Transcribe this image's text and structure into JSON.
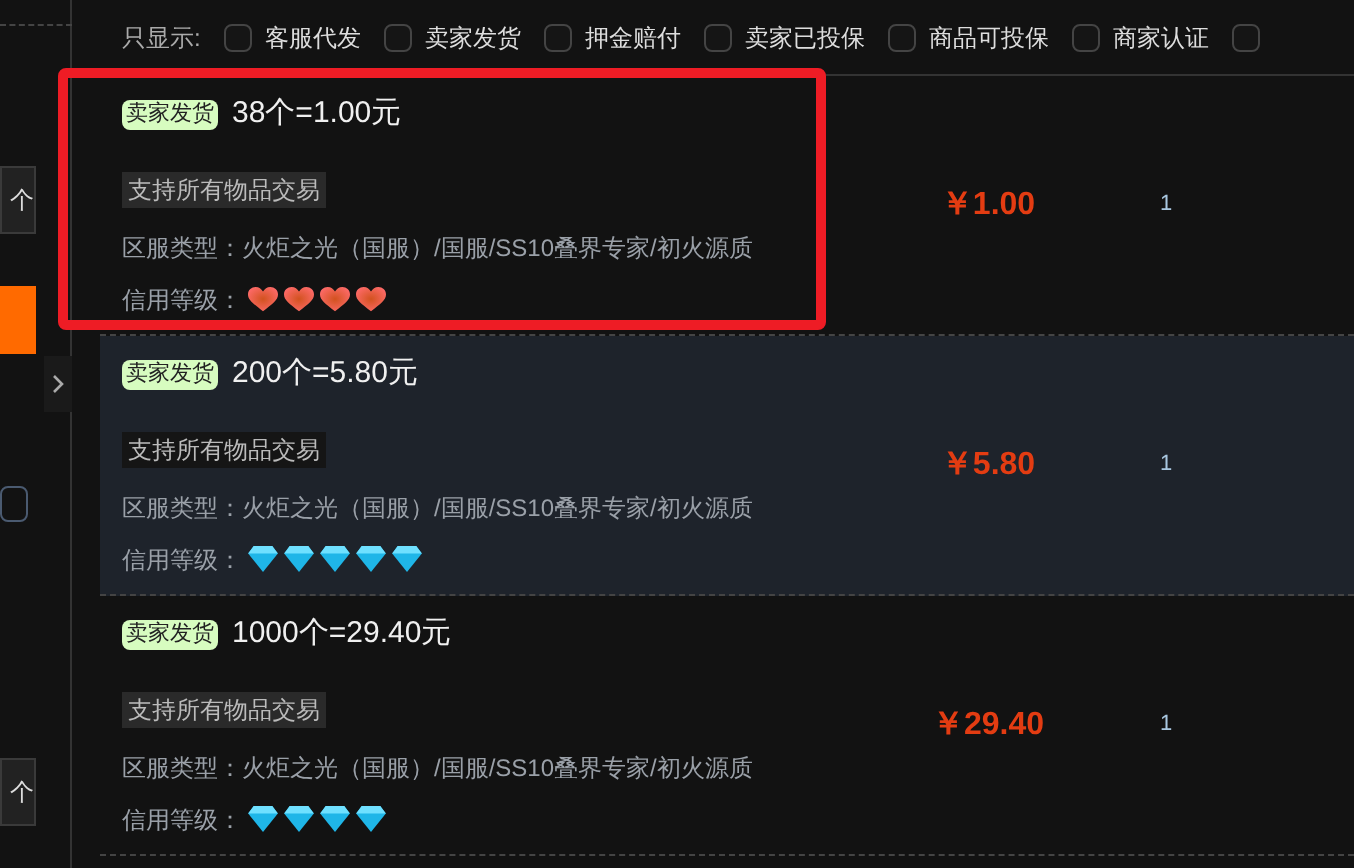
{
  "sidebar": {
    "items": [
      {
        "kind": "box",
        "text": "个"
      },
      {
        "kind": "accent"
      },
      {
        "kind": "box"
      },
      {
        "kind": "box",
        "text": "个"
      }
    ]
  },
  "filter_bar": {
    "label": "只显示:",
    "options": [
      {
        "label": "客服代发",
        "checked": false
      },
      {
        "label": "卖家发货",
        "checked": false
      },
      {
        "label": "押金赔付",
        "checked": false
      },
      {
        "label": "卖家已投保",
        "checked": false
      },
      {
        "label": "商品可投保",
        "checked": false
      },
      {
        "label": "商家认证",
        "checked": false
      },
      {
        "checked": false
      }
    ]
  },
  "listings": [
    {
      "badge": "卖家发货",
      "title": "38个=1.00元",
      "tag": "支持所有物品交易",
      "server": "区服类型：火炬之光（国服）/国服/SS10叠界专家/初火源质",
      "credit_label": "信用等级：",
      "credit": {
        "kind": "heart",
        "stars": 4
      },
      "price": "￥1.00",
      "quantity": "1",
      "outlined": true,
      "highlighted": false
    },
    {
      "badge": "卖家发货",
      "title": "200个=5.80元",
      "tag": "支持所有物品交易",
      "server": "区服类型：火炬之光（国服）/国服/SS10叠界专家/初火源质",
      "credit_label": "信用等级：",
      "credit": {
        "kind": "diamond",
        "stars": 5
      },
      "price": "￥5.80",
      "quantity": "1",
      "outlined": false,
      "highlighted": true
    },
    {
      "badge": "卖家发货",
      "title": "1000个=29.40元",
      "tag": "支持所有物品交易",
      "server": "区服类型：火炬之光（国服）/国服/SS10叠界专家/初火源质",
      "credit_label": "信用等级：",
      "credit": {
        "kind": "diamond",
        "stars": 4
      },
      "price": "￥29.40",
      "quantity": "1",
      "outlined": false,
      "highlighted": false
    }
  ]
}
